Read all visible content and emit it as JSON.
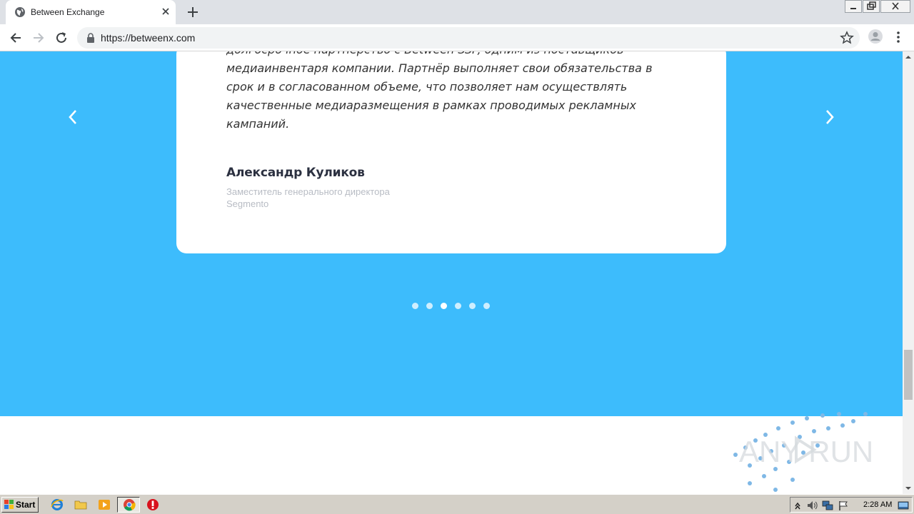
{
  "browser": {
    "tab_title": "Between Exchange",
    "url": "https://betweenx.com"
  },
  "testimonial": {
    "lines": [
      "долгосрочное партнерство с Between SSP, одним из поставщиков",
      "медиаинвентаря компании. Партнёр выполняет свои обязательства в",
      "срок и в согласованном объеме, что позволяет нам осуществлять",
      "качественные медиаразмещения в рамках проводимых рекламных",
      "кампаний."
    ],
    "author_name": "Александр Куликов",
    "author_role": "Заместитель генерального директора",
    "author_company": "Segmento"
  },
  "carousel": {
    "dot_count": 6,
    "active_index": 2
  },
  "watermark": {
    "text": "ANY RUN"
  },
  "taskbar": {
    "start_label": "Start",
    "clock": "2:28 AM"
  },
  "colors": {
    "band": "#3dbcfc",
    "card": "#ffffff"
  }
}
